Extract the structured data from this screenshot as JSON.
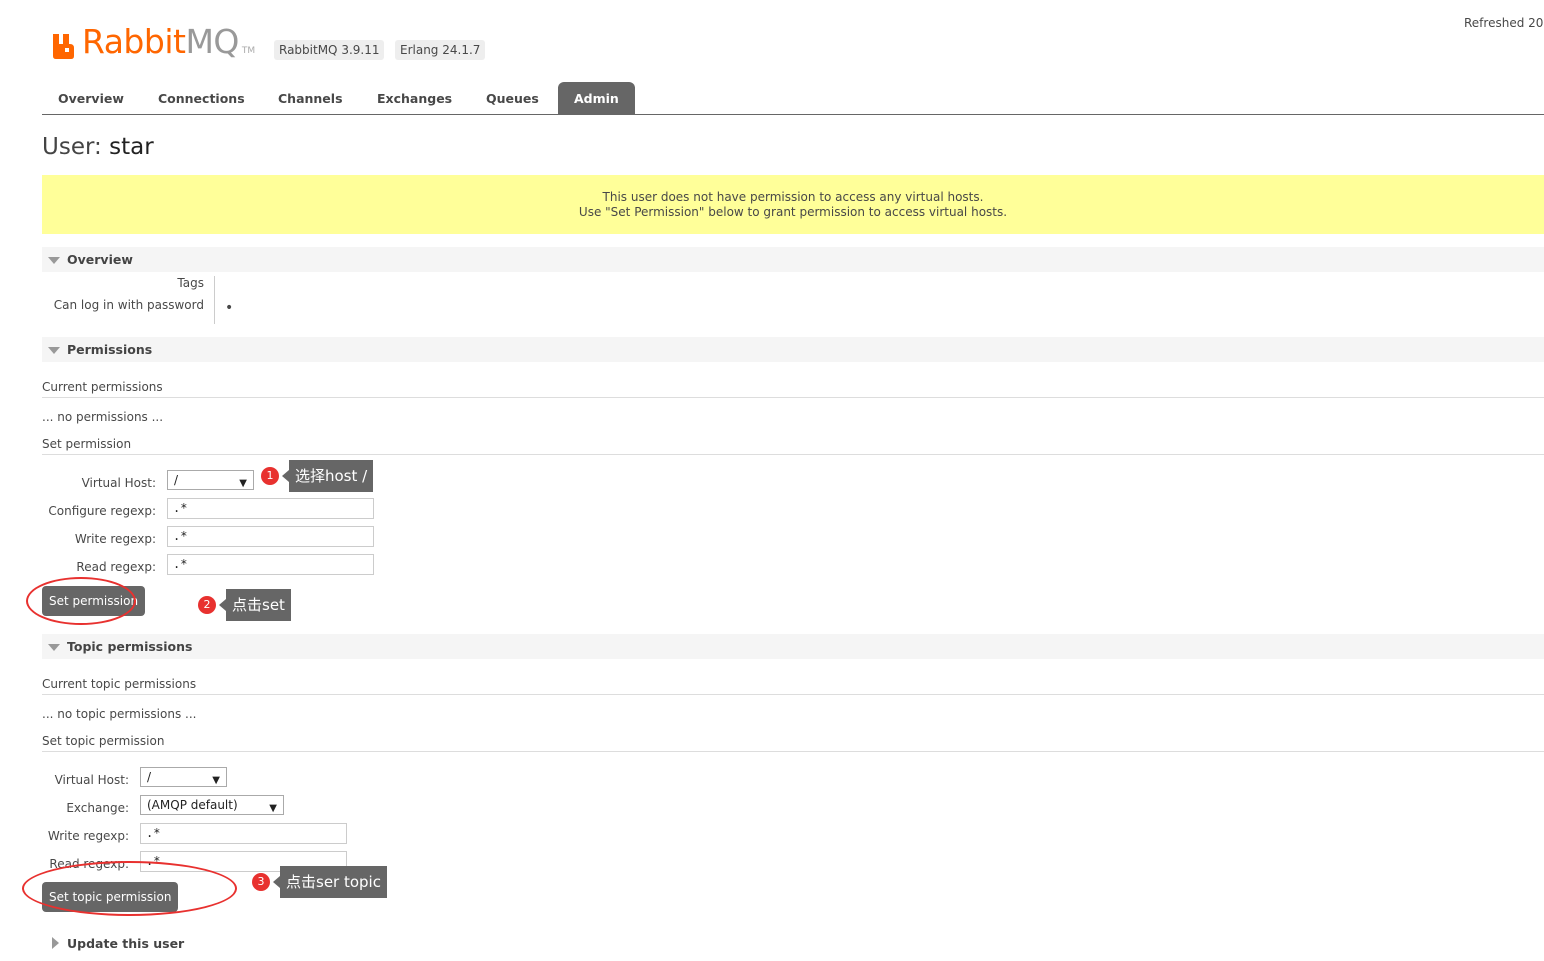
{
  "header": {
    "logo_rabbit": "Rabbit",
    "logo_mq": "MQ",
    "logo_tm": "TM",
    "rabbitmq_version": "RabbitMQ 3.9.11",
    "erlang_version": "Erlang 24.1.7",
    "refreshed": "Refreshed 20"
  },
  "tabs": [
    "Overview",
    "Connections",
    "Channels",
    "Exchanges",
    "Queues",
    "Admin"
  ],
  "active_tab": "Admin",
  "page": {
    "title_prefix": "User:",
    "username": "star"
  },
  "warning": {
    "line1": "This user does not have permission to access any virtual hosts.",
    "line2": "Use \"Set Permission\" below to grant permission to access virtual hosts."
  },
  "overview": {
    "heading": "Overview",
    "tags_label": "Tags",
    "login_label": "Can log in with password",
    "login_value": "•"
  },
  "permissions": {
    "heading": "Permissions",
    "current_heading": "Current permissions",
    "none_text": "... no permissions ...",
    "set_heading": "Set permission",
    "vhost_label": "Virtual Host:",
    "vhost_value": "/",
    "configure_label": "Configure regexp:",
    "configure_value": ".*",
    "write_label": "Write regexp:",
    "write_value": ".*",
    "read_label": "Read regexp:",
    "read_value": ".*",
    "submit": "Set permission"
  },
  "topic_permissions": {
    "heading": "Topic permissions",
    "current_heading": "Current topic permissions",
    "none_text": "... no topic permissions ...",
    "set_heading": "Set topic permission",
    "vhost_label": "Virtual Host:",
    "vhost_value": "/",
    "exchange_label": "Exchange:",
    "exchange_value": "(AMQP default)",
    "write_label": "Write regexp:",
    "write_value": ".*",
    "read_label": "Read regexp:",
    "read_value": ".*",
    "submit": "Set topic permission"
  },
  "update_section": {
    "heading": "Update this user"
  },
  "annotations": [
    {
      "number": "1",
      "text": "选择host /"
    },
    {
      "number": "2",
      "text": "点击set"
    },
    {
      "number": "3",
      "text": "点击ser topic"
    }
  ],
  "colors": {
    "brand_orange": "#ff6600",
    "tab_active": "#666666",
    "warning_bg": "#ffff99",
    "annotation_red": "#e8312f"
  }
}
